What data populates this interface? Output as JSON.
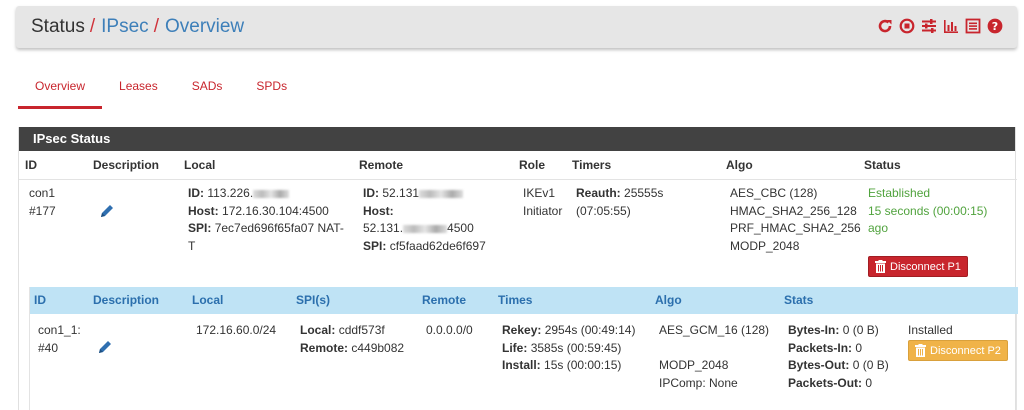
{
  "breadcrumb": {
    "status": "Status",
    "sep": "/",
    "ipsec": "IPsec",
    "overview": "Overview"
  },
  "header_icons": [
    "restart-icon",
    "stop-icon",
    "settings-sliders-icon",
    "bar-chart-icon",
    "log-list-icon",
    "help-icon"
  ],
  "tabs": [
    {
      "label": "Overview",
      "active": true
    },
    {
      "label": "Leases",
      "active": false
    },
    {
      "label": "SADs",
      "active": false
    },
    {
      "label": "SPDs",
      "active": false
    }
  ],
  "panel": {
    "title": "IPsec Status",
    "columns": [
      "ID",
      "Description",
      "Local",
      "Remote",
      "Role",
      "Timers",
      "Algo",
      "Status"
    ],
    "row": {
      "id": [
        "con1",
        "#177"
      ],
      "local": {
        "id_label": "ID:",
        "id_value": "113.226.",
        "host_label": "Host:",
        "host_value": "172.16.30.104:4500",
        "spi_label": "SPI:",
        "spi_value_1": "7ec7ed696f65fa07 NAT-",
        "spi_value_2": "T"
      },
      "remote": {
        "id_label": "ID:",
        "id_value": "52.131",
        "host_label": "Host:",
        "host_value_a": "52.131.",
        "host_value_b": "4500",
        "spi_label": "SPI:",
        "spi_value": "cf5faad62de6f697"
      },
      "role": [
        "IKEv1",
        "Initiator"
      ],
      "timers": {
        "reauth_label": "Reauth:",
        "reauth_value": "25555s",
        "reauth_paren": "(07:05:55)"
      },
      "algo": [
        "AES_CBC (128)",
        "HMAC_SHA2_256_128",
        "PRF_HMAC_SHA2_256",
        "MODP_2048"
      ],
      "status": [
        "Established",
        "15 seconds (00:00:15)",
        "ago"
      ],
      "disconnect_label": "Disconnect P1"
    },
    "child": {
      "columns": [
        "ID",
        "Description",
        "Local",
        "SPI(s)",
        "Remote",
        "Times",
        "Algo",
        "Stats"
      ],
      "id": [
        "con1_1:",
        "#40"
      ],
      "local": "172.16.60.0/24",
      "spis": {
        "local_label": "Local:",
        "local_value": "cddf573f",
        "remote_label": "Remote:",
        "remote_value": "c449b082"
      },
      "remote": "0.0.0.0/0",
      "times": {
        "rekey_label": "Rekey:",
        "rekey_value": "2954s (00:49:14)",
        "life_label": "Life:",
        "life_value": "3585s (00:59:45)",
        "install_label": "Install:",
        "install_value": "15s (00:00:15)"
      },
      "algo": [
        "AES_GCM_16 (128)",
        "",
        "MODP_2048",
        "IPComp: None"
      ],
      "stats": {
        "bytes_in_label": "Bytes-In:",
        "bytes_in_value": "0 (0 B)",
        "packets_in_label": "Packets-In:",
        "packets_in_value": "0",
        "bytes_out_label": "Bytes-Out:",
        "bytes_out_value": "0 (0 B)",
        "packets_out_label": "Packets-Out:",
        "packets_out_value": "0"
      },
      "state": "Installed",
      "disconnect_label": "Disconnect P2"
    }
  },
  "colors": {
    "accent_red": "#c8252d",
    "link_blue": "#3d7fb9",
    "green": "#51a33e",
    "child_head": "#bfe3f5",
    "warn": "#f0b348"
  }
}
